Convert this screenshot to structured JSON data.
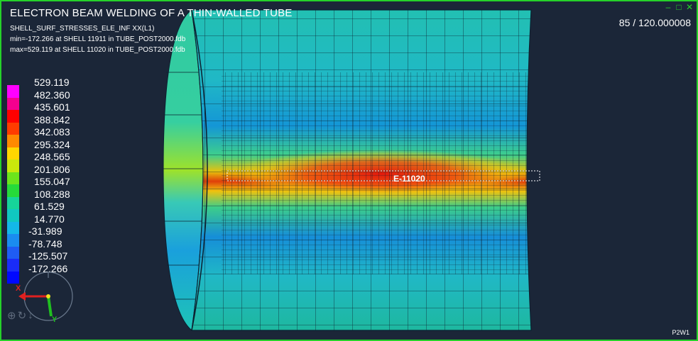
{
  "window": {
    "title": "ELECTRON BEAM WELDING OF A THIN-WALLED TUBE",
    "controls": [
      "minimize-icon",
      "maximize-icon",
      "close-icon"
    ],
    "frame_color": "#25d12a"
  },
  "info": {
    "line1": "SHELL_SURF_STRESSES_ELE_INF  XX(L1)",
    "line2": "min=-172.266  at  SHELL  11911  in  TUBE_POST2000.fdb",
    "line3": "max=529.119  at  SHELL  11020  in  TUBE_POST2000.fdb"
  },
  "frame_counter": "85  /  120.000008",
  "viewport_id": "P2W1",
  "element_label": "E-11020",
  "legend": {
    "values": [
      "529.119",
      "482.360",
      "435.601",
      "388.842",
      "342.083",
      "295.324",
      "248.565",
      "201.806",
      "155.047",
      "108.288",
      "61.529",
      "14.770",
      "-31.989",
      "-78.748",
      "-125.507",
      "-172.266"
    ],
    "colors": [
      "#ff00ff",
      "#f4008f",
      "#ff0000",
      "#ff3c00",
      "#ff8a00",
      "#ffd700",
      "#c9e80c",
      "#6ce41c",
      "#26da3a",
      "#16d49a",
      "#10c8c0",
      "#14b8e8",
      "#1a8cf0",
      "#1f5cf4",
      "#1a2cf8",
      "#0008ff"
    ]
  },
  "triad": {
    "x_label": "X",
    "y_label": "Y",
    "x_color": "#e02020",
    "y_color": "#20c020"
  },
  "bottom_tools": [
    "zoom-icon",
    "rotate-icon",
    "pan-icon"
  ]
}
